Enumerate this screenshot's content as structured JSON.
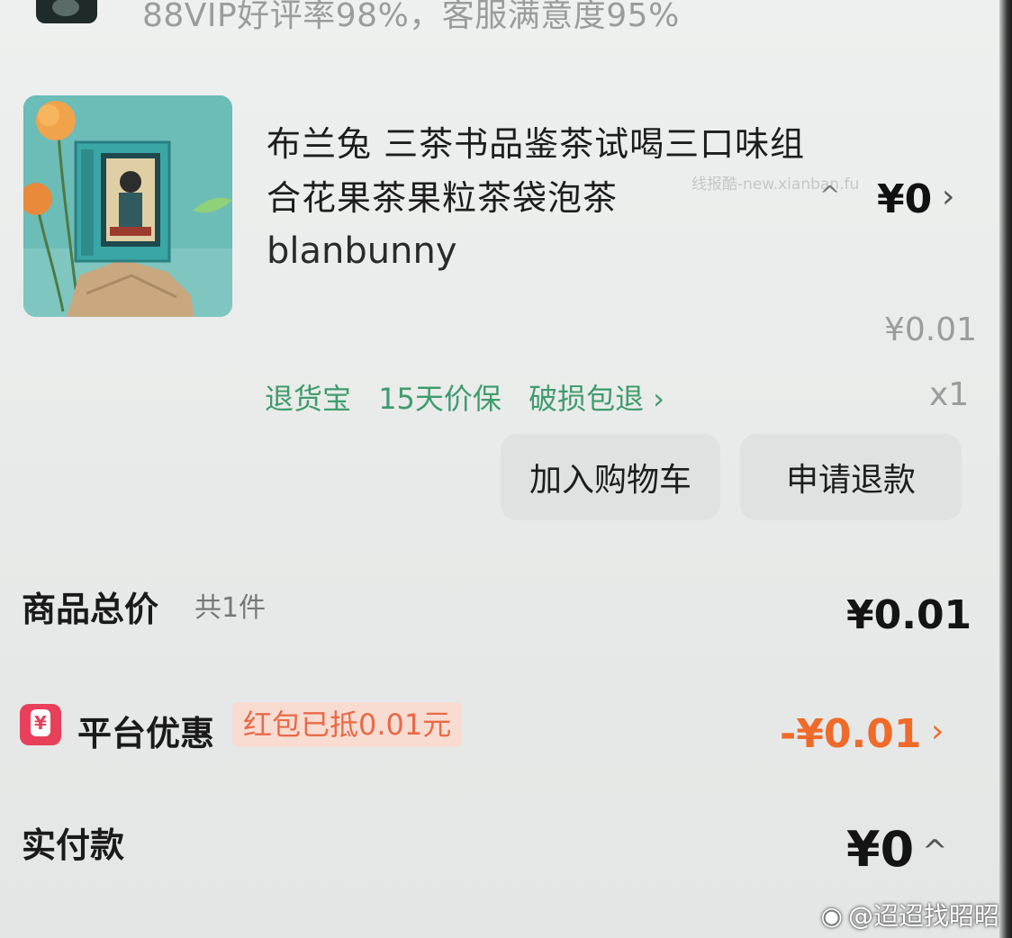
{
  "store": {
    "rating_text": "88VIP好评率98%，客服满意度95%"
  },
  "product": {
    "title": "布兰兔 三茶书品鉴茶试喝三口味组合花果茶果粒茶袋泡茶",
    "brand": "blanbunny",
    "watermark": "线报酷-new.xianban.fu",
    "paid_price": "¥0",
    "unit_price": "¥0.01",
    "quantity": "x1",
    "services": [
      "退货宝",
      "15天价保",
      "破损包退 ›"
    ],
    "image": "product-thumbnail"
  },
  "actions": {
    "add_to_cart": "加入购物车",
    "refund": "申请退款"
  },
  "summary": {
    "total_label": "商品总价",
    "total_count": "共1件",
    "total_amount": "¥0.01",
    "discount_label": "平台优惠",
    "discount_badge": "红包已抵0.01元",
    "discount_amount": "-¥0.01",
    "paid_label": "实付款",
    "paid_amount": "¥0"
  },
  "overlay": {
    "weibo_handle": "@迢迢找昭昭"
  },
  "colors": {
    "service_green": "#3f9b6e",
    "discount_orange": "#f06a2a",
    "badge_bg": "#f8dcd2",
    "discount_icon": "#e8405a"
  }
}
